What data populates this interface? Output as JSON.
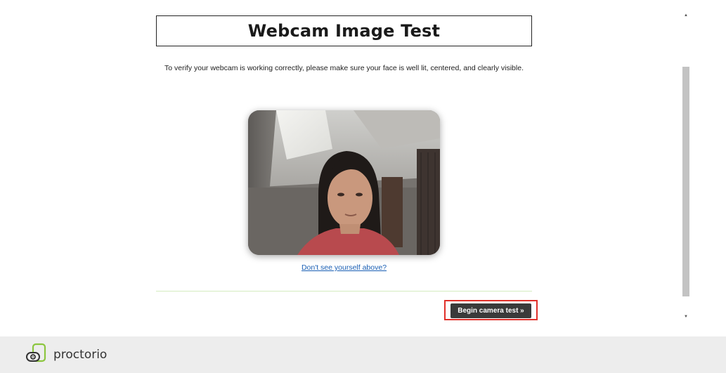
{
  "page": {
    "title": "Webcam Image Test",
    "instructions": "To verify your webcam is working correctly, please make sure your face is well lit, centered, and clearly visible.",
    "help_link": "Don't see yourself above?",
    "begin_button": "Begin camera test »"
  },
  "scrollbar": {
    "up_arrow": "▲",
    "down_arrow": "▼"
  },
  "footer": {
    "brand_name": "proctorio",
    "logo_icon": "proctorio-logo-icon"
  },
  "colors": {
    "button_bg": "#3a3a3a",
    "highlight": "#e0302a",
    "link": "#1a5fb4",
    "footer_bg": "#ededed",
    "logo_green": "#8cc63f"
  }
}
